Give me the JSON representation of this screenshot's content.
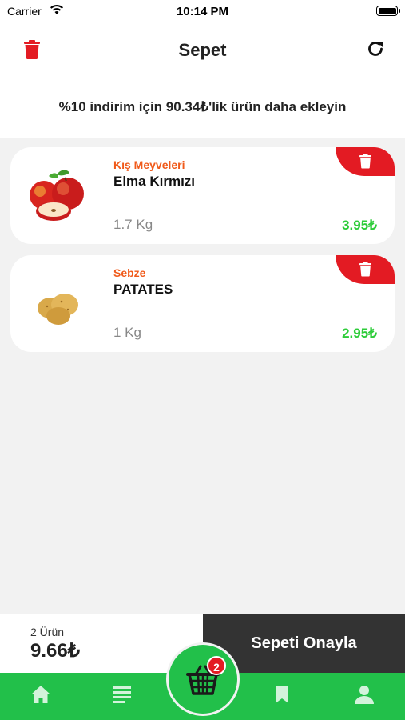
{
  "status_bar": {
    "carrier": "Carrier",
    "time": "10:14 PM"
  },
  "header": {
    "title": "Sepet"
  },
  "promo": {
    "text": "%10 indirim için 90.34₺'lik ürün daha ekleyin"
  },
  "cart": {
    "items": [
      {
        "category": "Kış Meyveleri",
        "name": "Elma Kırmızı",
        "weight": "1.7 Kg",
        "price": "3.95₺",
        "image": "red-apples"
      },
      {
        "category": "Sebze",
        "name": "PATATES",
        "weight": "1 Kg",
        "price": "2.95₺",
        "image": "potatoes"
      }
    ]
  },
  "summary": {
    "count": "2 Ürün",
    "total": "9.66₺",
    "confirm_label": "Sepeti Onayla"
  },
  "tabbar": {
    "cart_badge": "2",
    "icons": [
      "home-icon",
      "list-icon",
      "basket-icon",
      "bookmark-icon",
      "profile-icon"
    ]
  },
  "colors": {
    "accent_green": "#22c04a",
    "delete_red": "#e31b23",
    "category_orange": "#f05a1a",
    "price_green": "#2ecc3a"
  }
}
